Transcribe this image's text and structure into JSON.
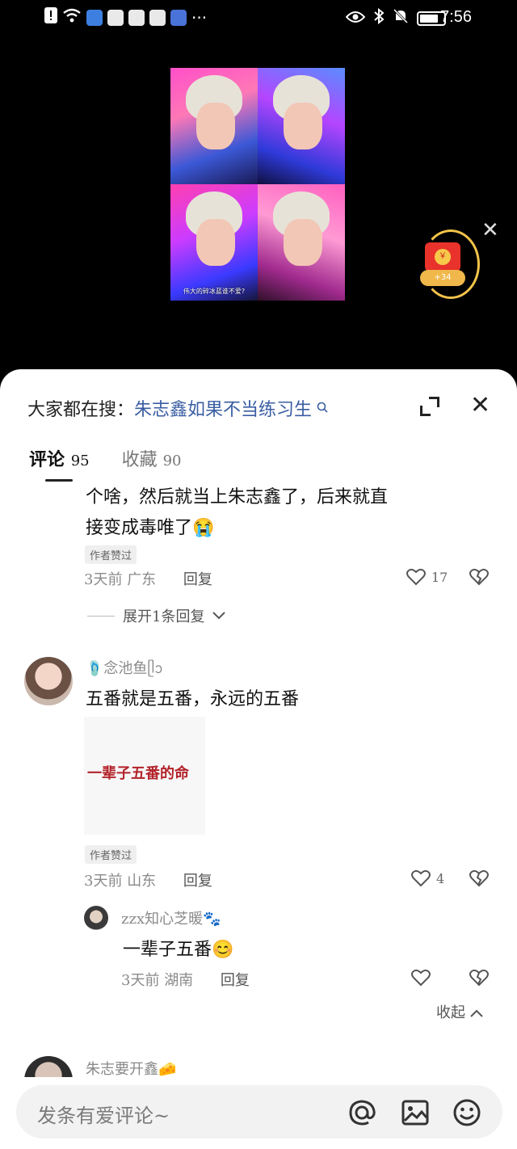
{
  "status_bar": {
    "time": "7:56",
    "left_icons": [
      "alert-icon",
      "wifi-icon",
      "app-icon",
      "paw-icon",
      "paw-icon",
      "paw-icon",
      "music-icon"
    ],
    "more": "···"
  },
  "video": {
    "captions": [
      "",
      "",
      "伟大的碎冰蓝谁不爱?",
      ""
    ]
  },
  "red_packet": {
    "amount": "+34"
  },
  "comments_sheet": {
    "search": {
      "prefix": "大家都在搜：",
      "query": "朱志鑫如果不当练习生"
    },
    "tabs": [
      {
        "label": "评论",
        "count": "95"
      },
      {
        "label": "收藏",
        "count": "90"
      }
    ],
    "comment1": {
      "lines": [
        "个啥，然后就当上朱志鑫了，后来就直",
        "接变成毒唯了"
      ],
      "emoji": "😭",
      "badge": "作者赞过",
      "time": "3天前",
      "location": "广东",
      "reply_label": "回复",
      "likes": "17",
      "expand_label": "展开1条回复"
    },
    "comment2": {
      "user": "🩴念池鱼ᥫᩣ",
      "text": "五番就是五番，永远的五番",
      "image_text": "一辈子五番的命",
      "badge": "作者赞过",
      "time": "3天前",
      "location": "山东",
      "reply_label": "回复",
      "likes": "4"
    },
    "reply": {
      "user": "zzx知心芝暖🐾",
      "text": "一辈子五番",
      "emoji": "😊",
      "time": "3天前",
      "location": "湖南",
      "reply_label": "回复"
    },
    "collapse_label": "收起",
    "comment3": {
      "user": "朱志要开鑫🧀"
    },
    "input": {
      "placeholder": "发条有爱评论~"
    }
  },
  "colors": {
    "link": "#3a5ea3",
    "red_text": "#b3232a",
    "packet": "#e8322b"
  }
}
